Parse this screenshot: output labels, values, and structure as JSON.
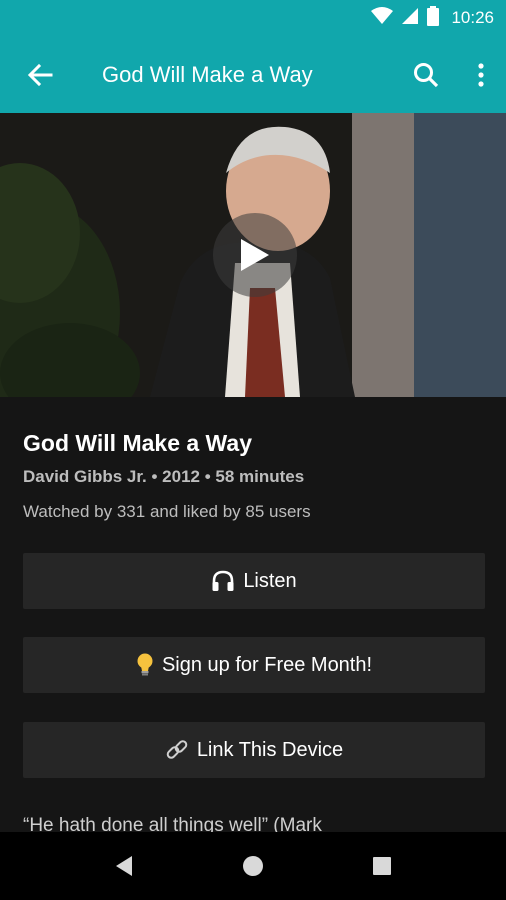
{
  "status_bar": {
    "time": "10:26"
  },
  "app_bar": {
    "title": "God Will Make a Way"
  },
  "video": {
    "title": "God Will Make a Way",
    "meta": "David Gibbs Jr. • 2012 • 58 minutes",
    "stats": "Watched by 331 and liked by 85 users"
  },
  "buttons": {
    "listen": {
      "icon": "headphones-icon",
      "label": "Listen"
    },
    "signup": {
      "icon": "lightbulb-icon",
      "label": "Sign up for Free Month!"
    },
    "link": {
      "icon": "link-icon",
      "label": "Link This Device"
    }
  },
  "description": {
    "text": "“He hath done all things well” (Mark"
  },
  "colors": {
    "primary": "#11a7ac",
    "background": "#151515",
    "button": "#262626",
    "muted_text": "#bdbdbd"
  }
}
